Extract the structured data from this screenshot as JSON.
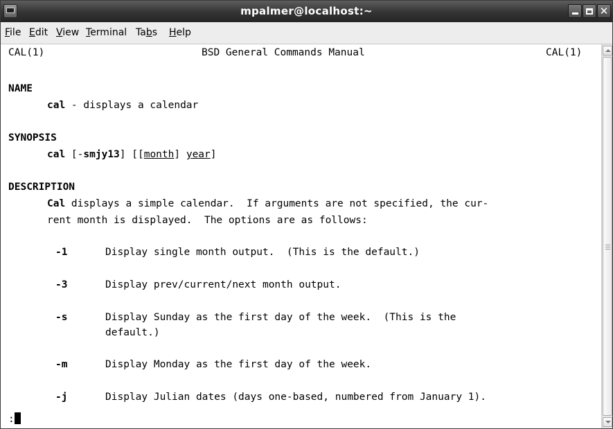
{
  "window": {
    "title": "mpalmer@localhost:~"
  },
  "menubar": {
    "items": [
      {
        "pre": "",
        "mn": "F",
        "post": "ile"
      },
      {
        "pre": "",
        "mn": "E",
        "post": "dit"
      },
      {
        "pre": "",
        "mn": "V",
        "post": "iew"
      },
      {
        "pre": "",
        "mn": "T",
        "post": "erminal"
      },
      {
        "pre": "Ta",
        "mn": "b",
        "post": "s"
      },
      {
        "pre": "",
        "mn": "H",
        "post": "elp"
      }
    ]
  },
  "terminal": {
    "header": {
      "left": "CAL(1)",
      "center": "BSD General Commands Manual",
      "right": "CAL(1)"
    },
    "name": {
      "heading": "NAME",
      "cmd": "cal",
      "desc": " - displays a calendar"
    },
    "synopsis": {
      "heading": "SYNOPSIS",
      "cmd": "cal",
      "p1": " [-",
      "flags": "smjy13",
      "p2": "] [[",
      "month": "month",
      "p3": "] ",
      "year": "year",
      "p4": "]"
    },
    "description": {
      "heading": "DESCRIPTION",
      "line1_bold": "Cal",
      "line1_rest": " displays a simple calendar.  If arguments are not specified, the cur-",
      "line2": "rent month is displayed.  The options are as follows:"
    },
    "options": [
      {
        "flag": "-1",
        "text1": "Display single month output.  (This is the default.)",
        "text2": ""
      },
      {
        "flag": "-3",
        "text1": "Display prev/current/next month output.",
        "text2": ""
      },
      {
        "flag": "-s",
        "text1": "Display Sunday as the first day of the week.  (This is the",
        "text2": "default.)"
      },
      {
        "flag": "-m",
        "text1": "Display Monday as the first day of the week.",
        "text2": ""
      },
      {
        "flag": "-j",
        "text1": "Display Julian dates (days one-based, numbered from January 1).",
        "text2": ""
      }
    ],
    "prompt": ":"
  }
}
